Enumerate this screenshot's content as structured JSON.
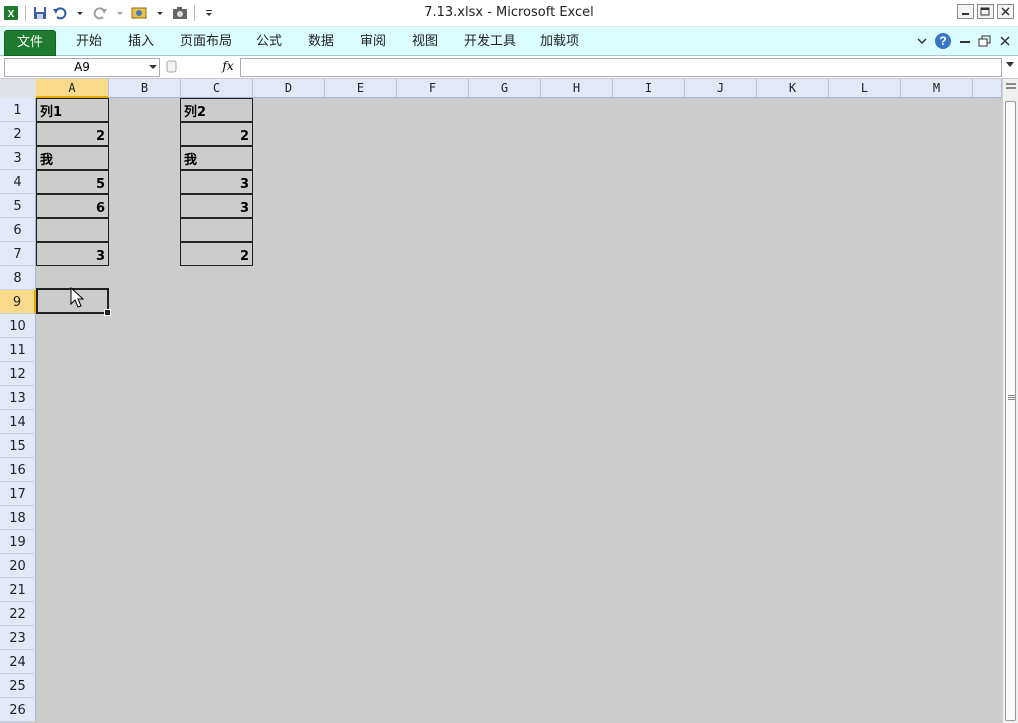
{
  "window": {
    "title": "7.13.xlsx  -  Microsoft Excel"
  },
  "ribbon": {
    "tabs": [
      "文件",
      "开始",
      "插入",
      "页面布局",
      "公式",
      "数据",
      "审阅",
      "视图",
      "开发工具",
      "加载项"
    ]
  },
  "formula_bar": {
    "name_box": "A9",
    "fx": "fx",
    "value": ""
  },
  "columns": [
    "A",
    "B",
    "C",
    "D",
    "E",
    "F",
    "G",
    "H",
    "I",
    "J",
    "K",
    "L",
    "M"
  ],
  "rows": [
    "1",
    "2",
    "3",
    "4",
    "5",
    "6",
    "7",
    "8",
    "9",
    "10",
    "11",
    "12",
    "13",
    "14",
    "15",
    "16",
    "17",
    "18",
    "19",
    "20",
    "21",
    "22",
    "23",
    "24",
    "25",
    "26"
  ],
  "selection": {
    "column": "A",
    "row": "9"
  },
  "cells": {
    "A1": "列1",
    "A2": "2",
    "A3": "我",
    "A4": "5",
    "A5": "6",
    "A6": "",
    "A7": "3",
    "C1": "列2",
    "C2": "2",
    "C3": "我",
    "C4": "3",
    "C5": "3",
    "C6": "",
    "C7": "2"
  },
  "colors": {
    "ribbon_bg": "#dcfdff",
    "file_tab": "#1e7b2e",
    "grid_bg": "#cccccc",
    "selection_header": "#f9d98a"
  },
  "icons": {
    "app": "excel-icon",
    "save": "save-icon",
    "undo": "undo-icon",
    "redo": "redo-icon",
    "help": "help-icon"
  }
}
